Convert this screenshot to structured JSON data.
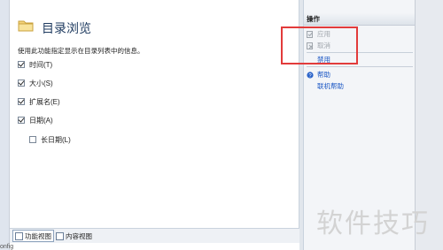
{
  "page": {
    "title": "目录浏览",
    "description": "使用此功能指定显示在目录列表中的信息。"
  },
  "options": [
    {
      "label": "时间(T)",
      "checked": true
    },
    {
      "label": "大小(S)",
      "checked": true
    },
    {
      "label": "扩展名(E)",
      "checked": true
    },
    {
      "label": "日期(A)",
      "checked": true
    },
    {
      "label": "长日期(L)",
      "checked": false
    }
  ],
  "view_tabs": {
    "features": "功能视图",
    "content": "内容视图"
  },
  "status": {
    "config": "onfig"
  },
  "actions": {
    "title": "操作",
    "apply": "应用",
    "cancel": "取消",
    "disable": "禁用",
    "help": "帮助",
    "online_help": "联机帮助"
  },
  "watermark": "软件技巧",
  "colors": {
    "highlight": "#e23b3b",
    "link": "#1a56c4",
    "disabled": "#a0a6ad"
  },
  "icons": {
    "folder": "folder-icon",
    "apply": "apply-icon",
    "cancel": "cancel-icon",
    "help": "help-icon"
  }
}
